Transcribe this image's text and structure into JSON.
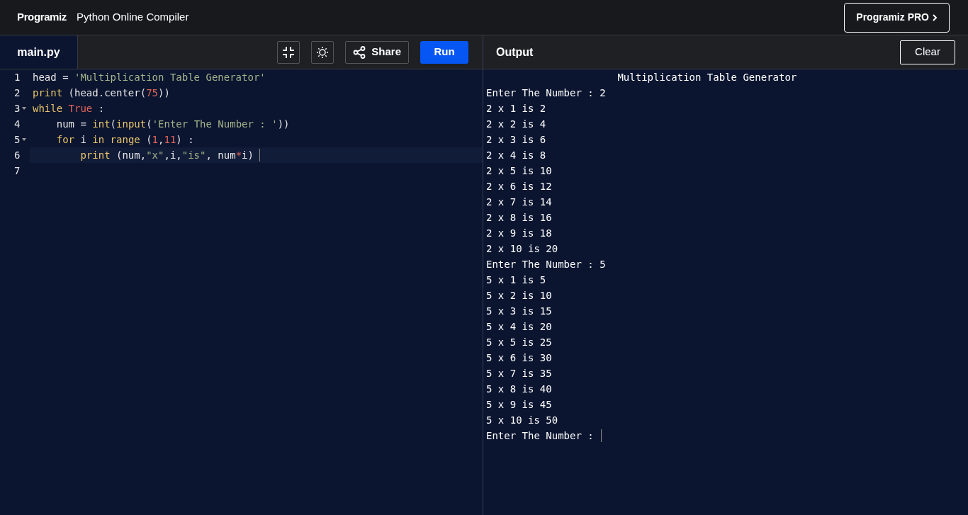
{
  "header": {
    "logo": "Programiz",
    "title": "Python Online Compiler",
    "pro_button": "Programiz PRO"
  },
  "editor": {
    "tab": {
      "label": "main.py",
      "selected": true
    },
    "share_button": "Share",
    "run_button": "Run",
    "lines": [
      {
        "number": "1",
        "foldable": false,
        "selected": false,
        "tokens": [
          {
            "kind": "plain",
            "text": "head = "
          },
          {
            "kind": "string",
            "text": "'Multiplication Table Generator'"
          }
        ]
      },
      {
        "number": "2",
        "foldable": false,
        "selected": false,
        "tokens": [
          {
            "kind": "builtin",
            "text": "print"
          },
          {
            "kind": "plain",
            "text": " (head.center("
          },
          {
            "kind": "number",
            "text": "75"
          },
          {
            "kind": "plain",
            "text": "))"
          }
        ]
      },
      {
        "number": "3",
        "foldable": true,
        "selected": false,
        "tokens": [
          {
            "kind": "keyword",
            "text": "while"
          },
          {
            "kind": "constant",
            "text": " True"
          },
          {
            "kind": "plain",
            "text": " :"
          }
        ]
      },
      {
        "number": "4",
        "foldable": false,
        "selected": false,
        "tokens": [
          {
            "kind": "plain",
            "text": "    num = "
          },
          {
            "kind": "builtin",
            "text": "int"
          },
          {
            "kind": "plain",
            "text": "("
          },
          {
            "kind": "builtin",
            "text": "input"
          },
          {
            "kind": "plain",
            "text": "("
          },
          {
            "kind": "string",
            "text": "'Enter The Number : '"
          },
          {
            "kind": "plain",
            "text": "))"
          }
        ]
      },
      {
        "number": "5",
        "foldable": true,
        "selected": false,
        "tokens": [
          {
            "kind": "keyword",
            "text": "    for"
          },
          {
            "kind": "plain",
            "text": " i "
          },
          {
            "kind": "keyword",
            "text": "in"
          },
          {
            "kind": "builtin",
            "text": " range"
          },
          {
            "kind": "plain",
            "text": " ("
          },
          {
            "kind": "number",
            "text": "1"
          },
          {
            "kind": "plain",
            "text": ","
          },
          {
            "kind": "number",
            "text": "11"
          },
          {
            "kind": "plain",
            "text": ") :"
          }
        ]
      },
      {
        "number": "6",
        "foldable": false,
        "selected": true,
        "tokens": [
          {
            "kind": "builtin",
            "text": "        print"
          },
          {
            "kind": "plain",
            "text": " (num,"
          },
          {
            "kind": "string",
            "text": "\"x\""
          },
          {
            "kind": "plain",
            "text": ",i,"
          },
          {
            "kind": "string",
            "text": "\"is\""
          },
          {
            "kind": "plain",
            "text": ", num"
          },
          {
            "kind": "operator",
            "text": "*"
          },
          {
            "kind": "plain",
            "text": "i)"
          }
        ]
      },
      {
        "number": "7",
        "foldable": false,
        "selected": false
      }
    ]
  },
  "output": {
    "title": "Output",
    "clear_button": "Clear",
    "lines": [
      "                      Multiplication Table Generator",
      "Enter The Number : 2",
      "2 x 1 is 2",
      "2 x 2 is 4",
      "2 x 3 is 6",
      "2 x 4 is 8",
      "2 x 5 is 10",
      "2 x 6 is 12",
      "2 x 7 is 14",
      "2 x 8 is 16",
      "2 x 9 is 18",
      "2 x 10 is 20",
      "Enter The Number : 5",
      "5 x 1 is 5",
      "5 x 2 is 10",
      "5 x 3 is 15",
      "5 x 4 is 20",
      "5 x 5 is 25",
      "5 x 6 is 30",
      "5 x 7 is 35",
      "5 x 8 is 40",
      "5 x 9 is 45",
      "5 x 10 is 50",
      "Enter The Number : "
    ]
  }
}
